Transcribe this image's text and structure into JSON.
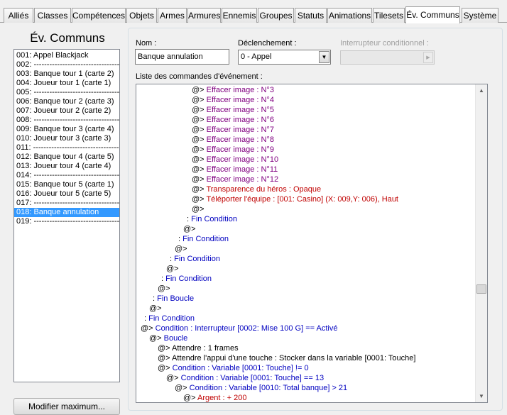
{
  "tabs": [
    {
      "label": "Alliés",
      "active": false
    },
    {
      "label": "Classes",
      "active": false
    },
    {
      "label": "Compétences",
      "active": false
    },
    {
      "label": "Objets",
      "active": false
    },
    {
      "label": "Armes",
      "active": false
    },
    {
      "label": "Armures",
      "active": false
    },
    {
      "label": "Ennemis",
      "active": false
    },
    {
      "label": "Groupes",
      "active": false
    },
    {
      "label": "Statuts",
      "active": false
    },
    {
      "label": "Animations",
      "active": false
    },
    {
      "label": "Tilesets",
      "active": false
    },
    {
      "label": "Év. Communs",
      "active": true
    },
    {
      "label": "Système",
      "active": false
    }
  ],
  "left_panel": {
    "title": "Év. Communs",
    "items": [
      {
        "label": "001: Appel Blackjack",
        "selected": false
      },
      {
        "label": "002: ------------------------------------------------",
        "selected": false
      },
      {
        "label": "003: Banque tour 1 (carte 2)",
        "selected": false
      },
      {
        "label": "004: Joueur tour 1 (carte 1)",
        "selected": false
      },
      {
        "label": "005: ------------------------------------------------",
        "selected": false
      },
      {
        "label": "006: Banque tour 2 (carte 3)",
        "selected": false
      },
      {
        "label": "007: Joueur tour 2 (carte 2)",
        "selected": false
      },
      {
        "label": "008: ------------------------------------------------",
        "selected": false
      },
      {
        "label": "009: Banque tour 3 (carte 4)",
        "selected": false
      },
      {
        "label": "010: Joueur tour 3 (carte 3)",
        "selected": false
      },
      {
        "label": "011: ------------------------------------------------",
        "selected": false
      },
      {
        "label": "012: Banque tour 4 (carte 5)",
        "selected": false
      },
      {
        "label": "013: Joueur tour 4 (carte 4)",
        "selected": false
      },
      {
        "label": "014: ------------------------------------------------",
        "selected": false
      },
      {
        "label": "015: Banque tour 5 (carte 1)",
        "selected": false
      },
      {
        "label": "016: Joueur tour 5 (carte 5)",
        "selected": false
      },
      {
        "label": "017: ------------------------------------------------",
        "selected": false
      },
      {
        "label": "018: Banque annulation",
        "selected": true
      },
      {
        "label": "019: ------------------------------------------------",
        "selected": false
      }
    ],
    "button_label": "Modifier maximum..."
  },
  "form": {
    "name_label": "Nom :",
    "name_value": "Banque annulation",
    "trigger_label": "Déclenchement :",
    "trigger_value": "0 - Appel",
    "switch_label": "Interrupteur conditionnel :",
    "switch_value": "",
    "commands_label": "Liste des commandes d'événement :"
  },
  "commands": [
    {
      "indent": 6,
      "marker": "@>",
      "text": "Effacer image : N°3",
      "color": "purple"
    },
    {
      "indent": 6,
      "marker": "@>",
      "text": "Effacer image : N°4",
      "color": "purple"
    },
    {
      "indent": 6,
      "marker": "@>",
      "text": "Effacer image : N°5",
      "color": "purple"
    },
    {
      "indent": 6,
      "marker": "@>",
      "text": "Effacer image : N°6",
      "color": "purple"
    },
    {
      "indent": 6,
      "marker": "@>",
      "text": "Effacer image : N°7",
      "color": "purple"
    },
    {
      "indent": 6,
      "marker": "@>",
      "text": "Effacer image : N°8",
      "color": "purple"
    },
    {
      "indent": 6,
      "marker": "@>",
      "text": "Effacer image : N°9",
      "color": "purple"
    },
    {
      "indent": 6,
      "marker": "@>",
      "text": "Effacer image : N°10",
      "color": "purple"
    },
    {
      "indent": 6,
      "marker": "@>",
      "text": "Effacer image : N°11",
      "color": "purple"
    },
    {
      "indent": 6,
      "marker": "@>",
      "text": "Effacer image : N°12",
      "color": "purple"
    },
    {
      "indent": 6,
      "marker": "@>",
      "text": "Transparence du héros : Opaque",
      "color": "red"
    },
    {
      "indent": 6,
      "marker": "@>",
      "text": "Téléporter l'équipe : [001: Casino] (X: 009,Y: 006), Haut",
      "color": "red"
    },
    {
      "indent": 6,
      "marker": "@>",
      "text": "",
      "color": "black"
    },
    {
      "indent": 5,
      "marker": ":",
      "text": "Fin Condition",
      "color": "blue"
    },
    {
      "indent": 5,
      "marker": "@>",
      "text": "",
      "color": "black"
    },
    {
      "indent": 4,
      "marker": ":",
      "text": "Fin Condition",
      "color": "blue"
    },
    {
      "indent": 4,
      "marker": "@>",
      "text": "",
      "color": "black"
    },
    {
      "indent": 3,
      "marker": ":",
      "text": "Fin Condition",
      "color": "blue"
    },
    {
      "indent": 3,
      "marker": "@>",
      "text": "",
      "color": "black"
    },
    {
      "indent": 2,
      "marker": ":",
      "text": "Fin Condition",
      "color": "blue"
    },
    {
      "indent": 2,
      "marker": "@>",
      "text": "",
      "color": "black"
    },
    {
      "indent": 1,
      "marker": ":",
      "text": "Fin Boucle",
      "color": "blue"
    },
    {
      "indent": 1,
      "marker": "@>",
      "text": "",
      "color": "black"
    },
    {
      "indent": 0,
      "marker": ":",
      "text": "Fin Condition",
      "color": "blue"
    },
    {
      "indent": 0,
      "marker": "@>",
      "text": "Condition : Interrupteur [0002: Mise 100 G] == Activé",
      "color": "blue"
    },
    {
      "indent": 1,
      "marker": "@>",
      "text": "Boucle",
      "color": "blue"
    },
    {
      "indent": 2,
      "marker": "@>",
      "text": "Attendre : 1 frames",
      "color": "black"
    },
    {
      "indent": 2,
      "marker": "@>",
      "text": "Attendre l'appui d'une touche : Stocker dans la variable [0001: Touche]",
      "color": "black"
    },
    {
      "indent": 2,
      "marker": "@>",
      "text": "Condition : Variable [0001: Touche] != 0",
      "color": "blue"
    },
    {
      "indent": 3,
      "marker": "@>",
      "text": "Condition : Variable [0001: Touche] == 13",
      "color": "blue"
    },
    {
      "indent": 4,
      "marker": "@>",
      "text": "Condition : Variable [0010: Total banque] > 21",
      "color": "blue"
    },
    {
      "indent": 5,
      "marker": "@>",
      "text": "Argent : + 200",
      "color": "red"
    }
  ],
  "colors": {
    "purple": "#800080",
    "red": "#c00000",
    "blue": "#0000c0",
    "black": "#000000",
    "selection": "#3399ff"
  },
  "icons": {
    "dropdown": "chevron-down-icon",
    "scroll_up": "arrow-up-icon",
    "scroll_down": "arrow-down-icon"
  }
}
